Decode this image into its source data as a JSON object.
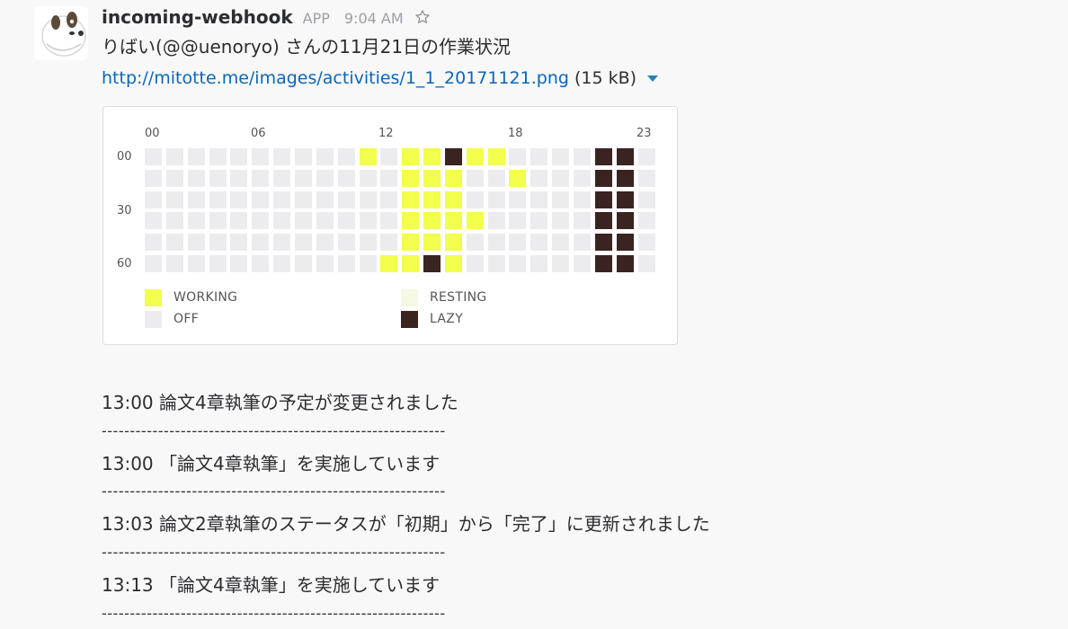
{
  "message": {
    "sender": "incoming-webhook",
    "badge": "APP",
    "time": "9:04 AM",
    "title": "りばい(@@uenoryo) さんの11月21日の作業状況",
    "link_text": "http://mitotte.me/images/activities/1_1_20171121.png",
    "file_size": "(15 kB)"
  },
  "colors": {
    "working": "#f2ff4d",
    "resting": "#f4f8e4",
    "off": "#ececee",
    "lazy": "#3a2422",
    "link": "#0b66b7"
  },
  "chart": {
    "hour_labels": [
      "00",
      "06",
      "12",
      "18",
      "23"
    ],
    "minute_labels": [
      "00",
      "30",
      "60"
    ],
    "legend": {
      "working": "WORKING",
      "resting": "RESTING",
      "off": "OFF",
      "lazy": "LAZY"
    }
  },
  "chart_data": {
    "type": "heatmap",
    "columns": 24,
    "rows": 6,
    "states": [
      "O",
      "W",
      "R",
      "L"
    ],
    "grid": [
      "OOOOOOOOOOWOWWLWWOOOOLLO",
      "OOOOOOOOOOOOWWWOOWOOOLLO",
      "OOOOOOOOOOOOWWWOOOOOOLLO",
      "OOOOOOOOOOOOWWWWOOOOOLLO",
      "OOOOOOOOOOOOWWWOOOOOOLLO",
      "OOOOOOOOOOOWWLWOOOOOOLLO"
    ]
  },
  "log": [
    {
      "text": "13:00 論文4章執筆の予定が変更されました"
    },
    {
      "text": "13:00 「論文4章執筆」を実施しています"
    },
    {
      "text": "13:03 論文2章執筆のステータスが「初期」から「完了」に更新されました"
    },
    {
      "text": "13:13 「論文4章執筆」を実施しています"
    }
  ],
  "separator": "-------------------------------------------------------------"
}
